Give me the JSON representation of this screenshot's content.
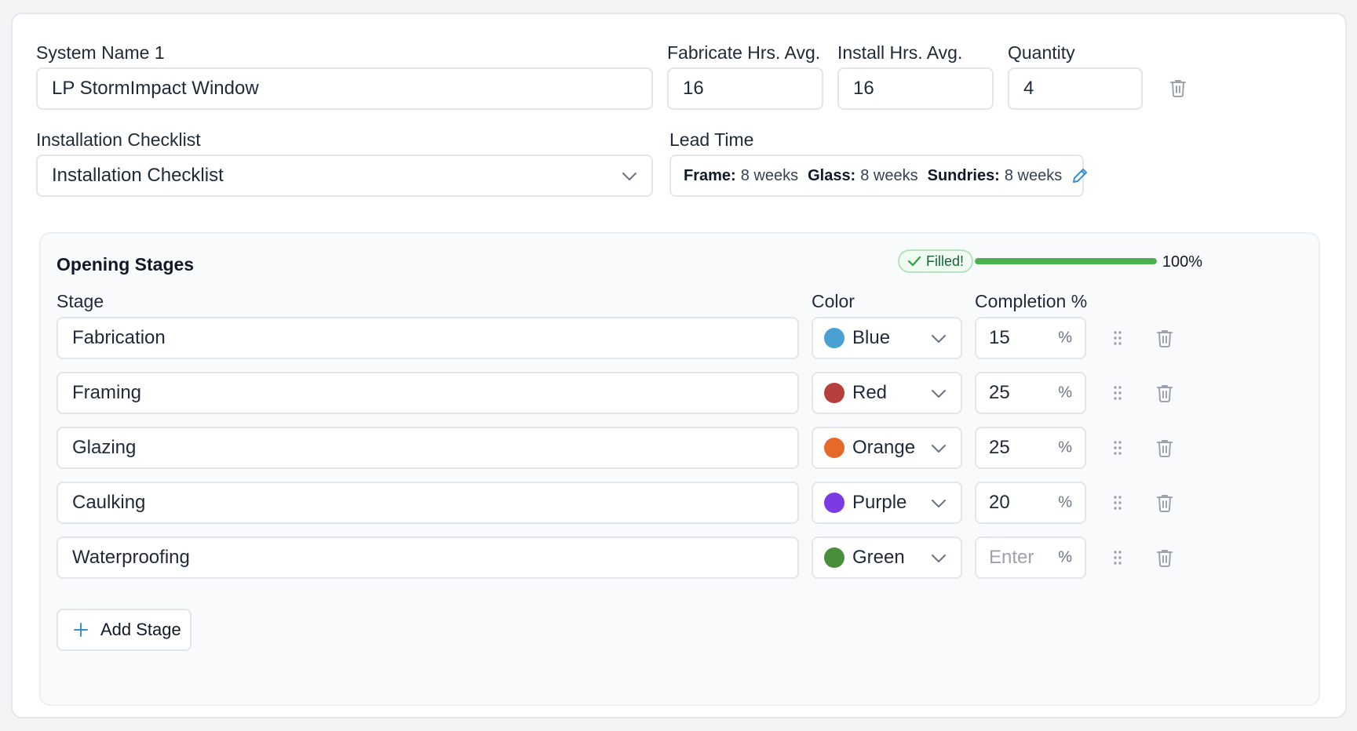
{
  "system": {
    "name_label": "System Name 1",
    "name_value": "LP StormImpact Window",
    "fabricate_label": "Fabricate Hrs. Avg.",
    "fabricate_value": "16",
    "install_label": "Install Hrs. Avg.",
    "install_value": "16",
    "quantity_label": "Quantity",
    "quantity_value": "4"
  },
  "checklist": {
    "label": "Installation Checklist",
    "selected": "Installation Checklist"
  },
  "lead_time": {
    "label": "Lead Time",
    "frame_label": "Frame:",
    "frame_value": "8 weeks",
    "glass_label": "Glass:",
    "glass_value": "8 weeks",
    "sundries_label": "Sundries:",
    "sundries_value": "8 weeks"
  },
  "stages_panel": {
    "title": "Opening Stages",
    "badge": "Filled!",
    "progress_value": 100,
    "progress_text": "100%",
    "col_stage": "Stage",
    "col_color": "Color",
    "col_completion": "Completion %",
    "percent_symbol": "%",
    "add_button": "Add Stage",
    "stages": [
      {
        "name": "Fabrication",
        "color_name": "Blue",
        "color_hex": "#4a9fd4",
        "completion": "15",
        "placeholder": "Enter"
      },
      {
        "name": "Framing",
        "color_name": "Red",
        "color_hex": "#b5403c",
        "completion": "25",
        "placeholder": "Enter"
      },
      {
        "name": "Glazing",
        "color_name": "Orange",
        "color_hex": "#e5692b",
        "completion": "25",
        "placeholder": "Enter"
      },
      {
        "name": "Caulking",
        "color_name": "Purple",
        "color_hex": "#7c3ae6",
        "completion": "20",
        "placeholder": "Enter"
      },
      {
        "name": "Waterproofing",
        "color_name": "Green",
        "color_hex": "#4a8f3c",
        "completion": "",
        "placeholder": "Enter"
      }
    ]
  },
  "icons": {
    "trash": "trash-icon",
    "chevron": "chevron-down-icon",
    "edit": "pencil-icon",
    "check": "check-icon",
    "drag": "drag-handle-icon",
    "plus": "plus-icon"
  },
  "colors": {
    "accent": "#3b8fd0",
    "progress": "#4caf50",
    "badge_text": "#166534"
  }
}
